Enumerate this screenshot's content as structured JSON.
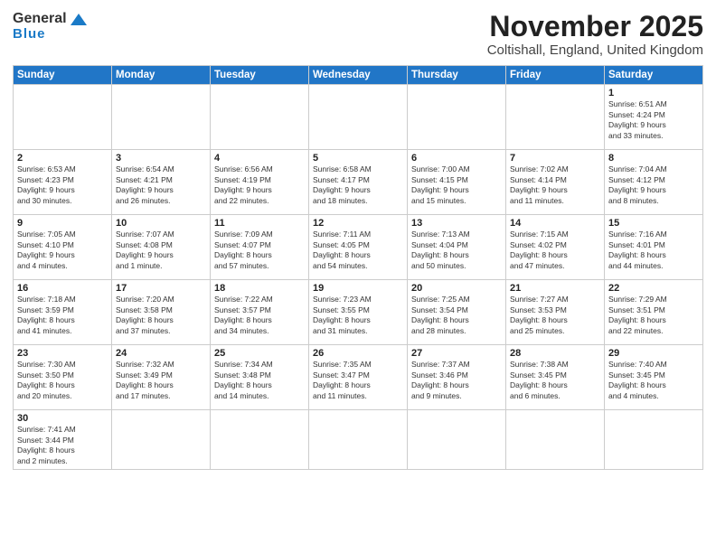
{
  "header": {
    "logo_general": "General",
    "logo_blue": "Blue",
    "title": "November 2025",
    "subtitle": "Coltishall, England, United Kingdom"
  },
  "weekdays": [
    "Sunday",
    "Monday",
    "Tuesday",
    "Wednesday",
    "Thursday",
    "Friday",
    "Saturday"
  ],
  "weeks": [
    [
      {
        "day": "",
        "info": ""
      },
      {
        "day": "",
        "info": ""
      },
      {
        "day": "",
        "info": ""
      },
      {
        "day": "",
        "info": ""
      },
      {
        "day": "",
        "info": ""
      },
      {
        "day": "",
        "info": ""
      },
      {
        "day": "1",
        "info": "Sunrise: 6:51 AM\nSunset: 4:24 PM\nDaylight: 9 hours\nand 33 minutes."
      }
    ],
    [
      {
        "day": "2",
        "info": "Sunrise: 6:53 AM\nSunset: 4:23 PM\nDaylight: 9 hours\nand 30 minutes."
      },
      {
        "day": "3",
        "info": "Sunrise: 6:54 AM\nSunset: 4:21 PM\nDaylight: 9 hours\nand 26 minutes."
      },
      {
        "day": "4",
        "info": "Sunrise: 6:56 AM\nSunset: 4:19 PM\nDaylight: 9 hours\nand 22 minutes."
      },
      {
        "day": "5",
        "info": "Sunrise: 6:58 AM\nSunset: 4:17 PM\nDaylight: 9 hours\nand 18 minutes."
      },
      {
        "day": "6",
        "info": "Sunrise: 7:00 AM\nSunset: 4:15 PM\nDaylight: 9 hours\nand 15 minutes."
      },
      {
        "day": "7",
        "info": "Sunrise: 7:02 AM\nSunset: 4:14 PM\nDaylight: 9 hours\nand 11 minutes."
      },
      {
        "day": "8",
        "info": "Sunrise: 7:04 AM\nSunset: 4:12 PM\nDaylight: 9 hours\nand 8 minutes."
      }
    ],
    [
      {
        "day": "9",
        "info": "Sunrise: 7:05 AM\nSunset: 4:10 PM\nDaylight: 9 hours\nand 4 minutes."
      },
      {
        "day": "10",
        "info": "Sunrise: 7:07 AM\nSunset: 4:08 PM\nDaylight: 9 hours\nand 1 minute."
      },
      {
        "day": "11",
        "info": "Sunrise: 7:09 AM\nSunset: 4:07 PM\nDaylight: 8 hours\nand 57 minutes."
      },
      {
        "day": "12",
        "info": "Sunrise: 7:11 AM\nSunset: 4:05 PM\nDaylight: 8 hours\nand 54 minutes."
      },
      {
        "day": "13",
        "info": "Sunrise: 7:13 AM\nSunset: 4:04 PM\nDaylight: 8 hours\nand 50 minutes."
      },
      {
        "day": "14",
        "info": "Sunrise: 7:15 AM\nSunset: 4:02 PM\nDaylight: 8 hours\nand 47 minutes."
      },
      {
        "day": "15",
        "info": "Sunrise: 7:16 AM\nSunset: 4:01 PM\nDaylight: 8 hours\nand 44 minutes."
      }
    ],
    [
      {
        "day": "16",
        "info": "Sunrise: 7:18 AM\nSunset: 3:59 PM\nDaylight: 8 hours\nand 41 minutes."
      },
      {
        "day": "17",
        "info": "Sunrise: 7:20 AM\nSunset: 3:58 PM\nDaylight: 8 hours\nand 37 minutes."
      },
      {
        "day": "18",
        "info": "Sunrise: 7:22 AM\nSunset: 3:57 PM\nDaylight: 8 hours\nand 34 minutes."
      },
      {
        "day": "19",
        "info": "Sunrise: 7:23 AM\nSunset: 3:55 PM\nDaylight: 8 hours\nand 31 minutes."
      },
      {
        "day": "20",
        "info": "Sunrise: 7:25 AM\nSunset: 3:54 PM\nDaylight: 8 hours\nand 28 minutes."
      },
      {
        "day": "21",
        "info": "Sunrise: 7:27 AM\nSunset: 3:53 PM\nDaylight: 8 hours\nand 25 minutes."
      },
      {
        "day": "22",
        "info": "Sunrise: 7:29 AM\nSunset: 3:51 PM\nDaylight: 8 hours\nand 22 minutes."
      }
    ],
    [
      {
        "day": "23",
        "info": "Sunrise: 7:30 AM\nSunset: 3:50 PM\nDaylight: 8 hours\nand 20 minutes."
      },
      {
        "day": "24",
        "info": "Sunrise: 7:32 AM\nSunset: 3:49 PM\nDaylight: 8 hours\nand 17 minutes."
      },
      {
        "day": "25",
        "info": "Sunrise: 7:34 AM\nSunset: 3:48 PM\nDaylight: 8 hours\nand 14 minutes."
      },
      {
        "day": "26",
        "info": "Sunrise: 7:35 AM\nSunset: 3:47 PM\nDaylight: 8 hours\nand 11 minutes."
      },
      {
        "day": "27",
        "info": "Sunrise: 7:37 AM\nSunset: 3:46 PM\nDaylight: 8 hours\nand 9 minutes."
      },
      {
        "day": "28",
        "info": "Sunrise: 7:38 AM\nSunset: 3:45 PM\nDaylight: 8 hours\nand 6 minutes."
      },
      {
        "day": "29",
        "info": "Sunrise: 7:40 AM\nSunset: 3:45 PM\nDaylight: 8 hours\nand 4 minutes."
      }
    ],
    [
      {
        "day": "30",
        "info": "Sunrise: 7:41 AM\nSunset: 3:44 PM\nDaylight: 8 hours\nand 2 minutes."
      },
      {
        "day": "",
        "info": ""
      },
      {
        "day": "",
        "info": ""
      },
      {
        "day": "",
        "info": ""
      },
      {
        "day": "",
        "info": ""
      },
      {
        "day": "",
        "info": ""
      },
      {
        "day": "",
        "info": ""
      }
    ]
  ]
}
